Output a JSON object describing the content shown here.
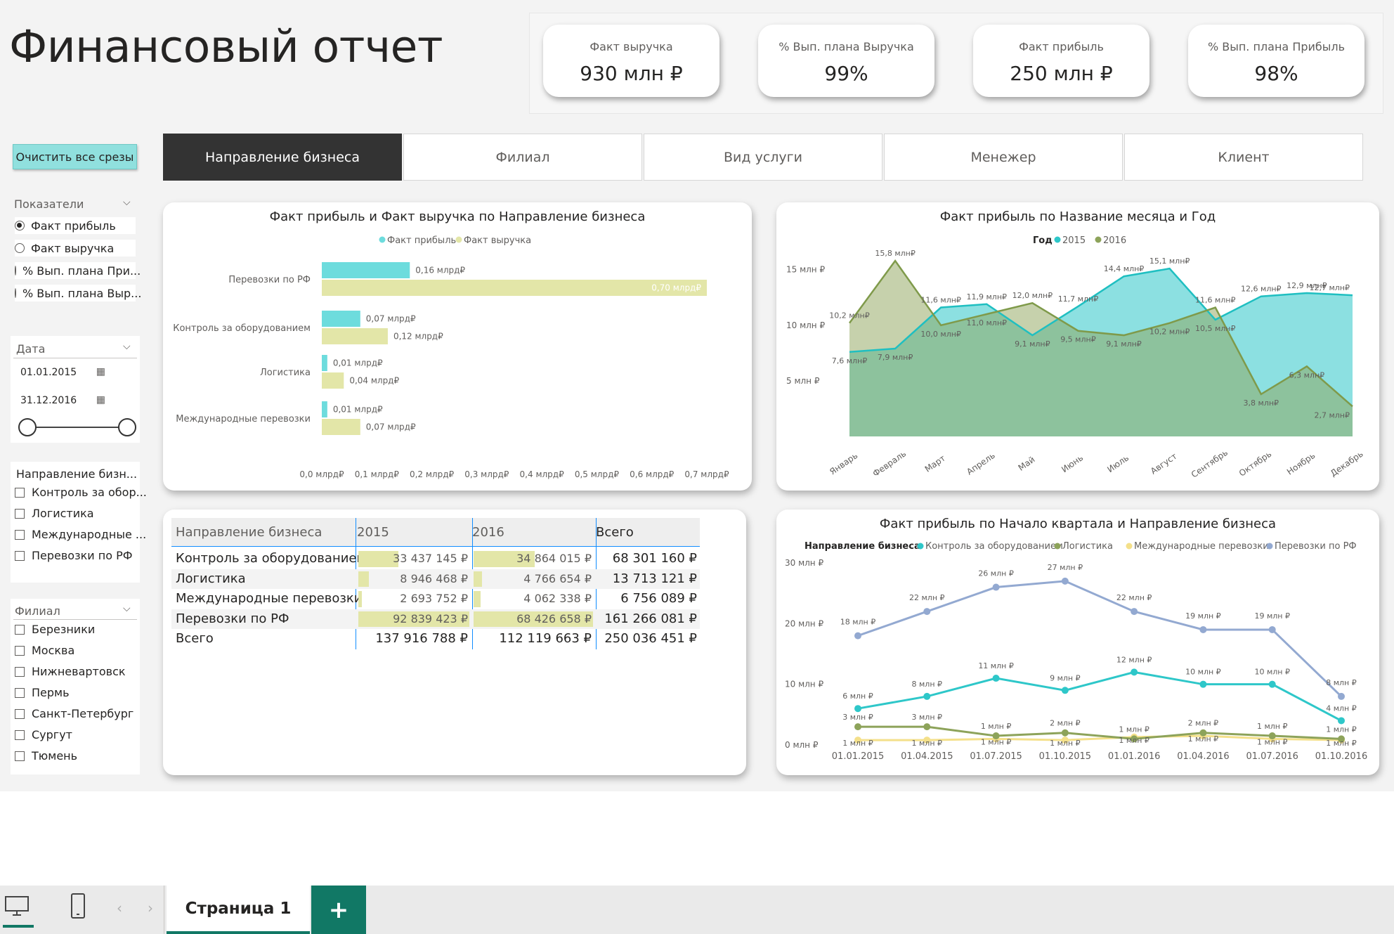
{
  "title": "Финансовый отчет",
  "kpis": [
    {
      "label": "Факт выручка",
      "value": "930 млн ₽"
    },
    {
      "label": "% Вып. плана Выручка",
      "value": "99%"
    },
    {
      "label": "Факт прибыль",
      "value": "250 млн ₽"
    },
    {
      "label": "% Вып. плана Прибыль",
      "value": "98%"
    }
  ],
  "clear_button": "Очистить все срезы",
  "tabs": [
    {
      "label": "Направление бизнеса",
      "active": true
    },
    {
      "label": "Филиал",
      "active": false
    },
    {
      "label": "Вид услуги",
      "active": false
    },
    {
      "label": "Менежер",
      "active": false
    },
    {
      "label": "Клиент",
      "active": false
    }
  ],
  "slicers": {
    "indicators": {
      "title": "Показатели",
      "options": [
        "Факт прибыль",
        "Факт выручка",
        "% Вып. плана При...",
        "% Вып. плана Выр..."
      ],
      "selected": 0
    },
    "date": {
      "title": "Дата",
      "from": "01.01.2015",
      "to": "31.12.2016"
    },
    "business": {
      "title": "Направление бизн...",
      "options": [
        "Контроль за обор...",
        "Логистика",
        "Международные ...",
        "Перевозки по РФ"
      ]
    },
    "branch": {
      "title": "Филиал",
      "options": [
        "Березники",
        "Москва",
        "Нижневартовск",
        "Пермь",
        "Санкт-Петербург",
        "Сургут",
        "Тюмень"
      ]
    }
  },
  "colors": {
    "teal": "#2ec7c9",
    "teal_light": "#6ddcdd",
    "olive": "#8da35a",
    "khaki": "#e3e6a8",
    "yellow": "#f4e08a",
    "lavender": "#93a9d1",
    "tab_active": "#333333",
    "page_tab_green": "#117865",
    "clear_button": "#90e0de"
  },
  "tables": {
    "business": {
      "headers": [
        "Направление бизнеса",
        "2015",
        "2016",
        "Всего"
      ],
      "rows": [
        {
          "name": "Контроль за оборудованием",
          "v2015": "33 437 145 ₽",
          "v2016": "34 864 015 ₽",
          "total": "68 301 160 ₽",
          "bar2015": 33437145,
          "bar2016": 34864015
        },
        {
          "name": "Логистика",
          "v2015": "8 946 468 ₽",
          "v2016": "4 766 654 ₽",
          "total": "13 713 121 ₽",
          "bar2015": 8946468,
          "bar2016": 4766654
        },
        {
          "name": "Международные перевозки",
          "v2015": "2 693 752 ₽",
          "v2016": "4 062 338 ₽",
          "total": "6 756 089 ₽",
          "bar2015": 2693752,
          "bar2016": 4062338
        },
        {
          "name": "Перевозки по РФ",
          "v2015": "92 839 423 ₽",
          "v2016": "68 426 658 ₽",
          "total": "161 266 081 ₽",
          "bar2015": 92839423,
          "bar2016": 68426658
        }
      ],
      "total_row": {
        "name": "Всего",
        "v2015": "137 916 788 ₽",
        "v2016": "112 119 663 ₽",
        "total": "250 036 451 ₽"
      }
    }
  },
  "chart_data": [
    {
      "type": "bar",
      "title": "Факт прибыль и Факт выручка по Направление бизнеса",
      "orientation": "horizontal",
      "categories": [
        "Перевозки по РФ",
        "Контроль за оборудованием",
        "Логистика",
        "Международные перевозки"
      ],
      "series": [
        {
          "name": "Факт прибыль",
          "values": [
            0.16,
            0.07,
            0.01,
            0.01
          ],
          "labels": [
            "0,16 млрд₽",
            "0,07 млрд₽",
            "0,01 млрд₽",
            "0,01 млрд₽"
          ]
        },
        {
          "name": "Факт выручка",
          "values": [
            0.7,
            0.12,
            0.04,
            0.07
          ],
          "labels": [
            "0,70 млрд₽",
            "0,12 млрд₽",
            "0,04 млрд₽",
            "0,07 млрд₽"
          ]
        }
      ],
      "xlim": [
        0,
        0.7
      ],
      "xticks": [
        "0,0 млрд₽",
        "0,1 млрд₽",
        "0,2 млрд₽",
        "0,3 млрд₽",
        "0,4 млрд₽",
        "0,5 млрд₽",
        "0,6 млрд₽",
        "0,7 млрд₽"
      ],
      "legend": "top-center"
    },
    {
      "type": "area",
      "title": "Факт прибыль по Название месяца и Год",
      "legend_title": "Год",
      "legend": "top-center",
      "categories": [
        "Январь",
        "Февраль",
        "Март",
        "Апрель",
        "Май",
        "Июнь",
        "Июль",
        "Август",
        "Сентябрь",
        "Октябрь",
        "Ноябрь",
        "Декабрь"
      ],
      "series": [
        {
          "name": "2015",
          "values": [
            7.6,
            7.9,
            11.6,
            11.9,
            9.1,
            11.7,
            14.4,
            15.1,
            10.5,
            12.6,
            12.9,
            12.7
          ],
          "labels": [
            "7,6 млн₽",
            "7,9 млн₽",
            "11,6 млн₽",
            "11,9 млн₽",
            "9,1 млн₽",
            "11,7 млн₽",
            "14,4 млн₽",
            "15,1 млн₽",
            "10,5 млн₽",
            "12,6 млн₽",
            "12,9 млн₽",
            "12,7 млн₽"
          ]
        },
        {
          "name": "2016",
          "values": [
            10.2,
            15.8,
            10.0,
            11.0,
            12.0,
            9.5,
            9.1,
            10.2,
            11.6,
            3.8,
            6.3,
            2.7
          ],
          "labels": [
            "10,2 млн₽",
            "15,8 млн₽",
            "10,0 млн₽",
            "11,0 млн₽",
            "12,0 млн₽",
            "9,5 млн₽",
            "9,1 млн₽",
            "10,2 млн₽",
            "11,6 млн₽",
            "3,8 млн₽",
            "6,3 млн₽",
            "2,7 млн₽"
          ]
        }
      ],
      "ylim": [
        0,
        16.5
      ],
      "yticks": [
        {
          "v": 5,
          "label": "5 млн ₽"
        },
        {
          "v": 10,
          "label": "10 млн ₽"
        },
        {
          "v": 15,
          "label": "15 млн ₽"
        }
      ]
    },
    {
      "type": "line",
      "title": "Факт прибыль по Начало квартала и Направление бизнеса",
      "legend_title": "Направление бизнеса",
      "legend": "top-left",
      "x": [
        "01.01.2015",
        "01.04.2015",
        "01.07.2015",
        "01.10.2015",
        "01.01.2016",
        "01.04.2016",
        "01.07.2016",
        "01.10.2016"
      ],
      "series": [
        {
          "name": "Контроль за оборудованием",
          "values": [
            6,
            8,
            11,
            9,
            12,
            10,
            10,
            4
          ],
          "labels": [
            "6 млн ₽",
            "8 млн ₽",
            "11 млн ₽",
            "9 млн ₽",
            "12 млн ₽",
            "10 млн ₽",
            "10 млн ₽",
            "4 млн ₽"
          ]
        },
        {
          "name": "Логистика",
          "values": [
            3,
            3,
            1.5,
            2,
            1,
            2,
            1.5,
            1
          ],
          "labels": [
            "3 млн ₽",
            "3 млн ₽",
            "1 млн ₽",
            "2 млн ₽",
            "1 млн ₽",
            "2 млн ₽",
            "1 млн ₽",
            "1 млн ₽"
          ]
        },
        {
          "name": "Международные перевозки",
          "values": [
            0.8,
            0.8,
            1,
            0.8,
            1.3,
            1.5,
            1,
            0.8
          ],
          "labels": [
            "1 млн ₽",
            "1 млн ₽",
            "1 млн ₽",
            "1 млн ₽",
            "1 млн ₽",
            "1 млн ₽",
            "1 млн ₽",
            "1 млн ₽"
          ]
        },
        {
          "name": "Перевозки по РФ",
          "values": [
            18,
            22,
            26,
            27,
            22,
            19,
            19,
            8
          ],
          "labels": [
            "18 млн ₽",
            "22 млн ₽",
            "26 млн ₽",
            "27 млн ₽",
            "22 млн ₽",
            "19 млн ₽",
            "19 млн ₽",
            "8 млн ₽"
          ]
        }
      ],
      "ylim": [
        0,
        30
      ],
      "yticks": [
        {
          "v": 0,
          "label": "0 млн ₽"
        },
        {
          "v": 10,
          "label": "10 млн ₽"
        },
        {
          "v": 20,
          "label": "20 млн ₽"
        },
        {
          "v": 30,
          "label": "30 млн ₽"
        }
      ]
    }
  ],
  "footer": {
    "page_tab": "Страница 1",
    "add_tab": "+"
  }
}
